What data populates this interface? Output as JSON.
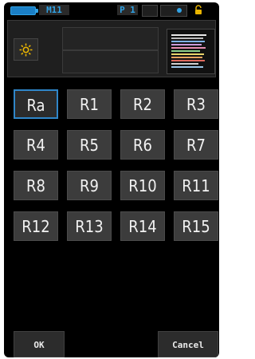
{
  "status": {
    "mode": "M11",
    "preset": "P 1"
  },
  "grid": {
    "cells": [
      "Ra",
      "R1",
      "R2",
      "R3",
      "R4",
      "R5",
      "R6",
      "R7",
      "R8",
      "R9",
      "R10",
      "R11",
      "R12",
      "R13",
      "R14",
      "R15"
    ],
    "selected_index": 0
  },
  "buttons": {
    "ok": "OK",
    "cancel": "Cancel"
  },
  "colors": {
    "accent": "#2f86c9",
    "sun": "#e9b400",
    "screen_bg": "#000000"
  },
  "icons": {
    "battery": "battery-icon",
    "lock": "lock-icon",
    "sun": "sun-icon",
    "spectrum": "spectrum-icon"
  }
}
